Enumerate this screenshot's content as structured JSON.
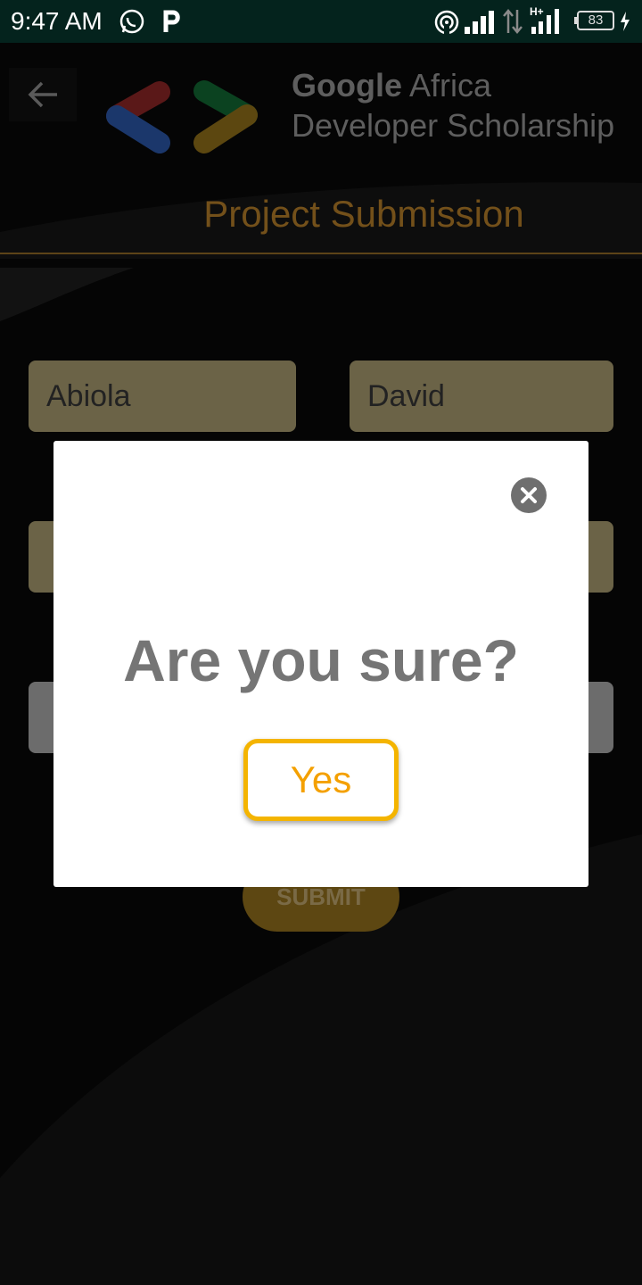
{
  "status_bar": {
    "time": "9:47 AM",
    "battery": "83",
    "icons": [
      "whatsapp-icon",
      "parking-icon",
      "hotspot-icon",
      "signal-icon",
      "data-transfer-icon",
      "signal-hplus-icon",
      "battery-icon",
      "charging-icon"
    ]
  },
  "header": {
    "back_icon": "arrow-left-icon",
    "logo": "google-developers-logo",
    "brand_bold": "Google",
    "brand_rest": " Africa",
    "subtitle": "Developer Scholarship",
    "page_title": "Project Submission"
  },
  "form": {
    "first_name_value": "Abiola",
    "last_name_value": "David",
    "submit_label": "SUBMIT"
  },
  "dialog": {
    "close_icon": "close-icon",
    "title": "Are you sure?",
    "confirm_label": "Yes"
  },
  "colors": {
    "status_bar": "#04231d",
    "accent": "#f4b400",
    "page_title": "#73501a",
    "dialog_text": "#757575"
  }
}
